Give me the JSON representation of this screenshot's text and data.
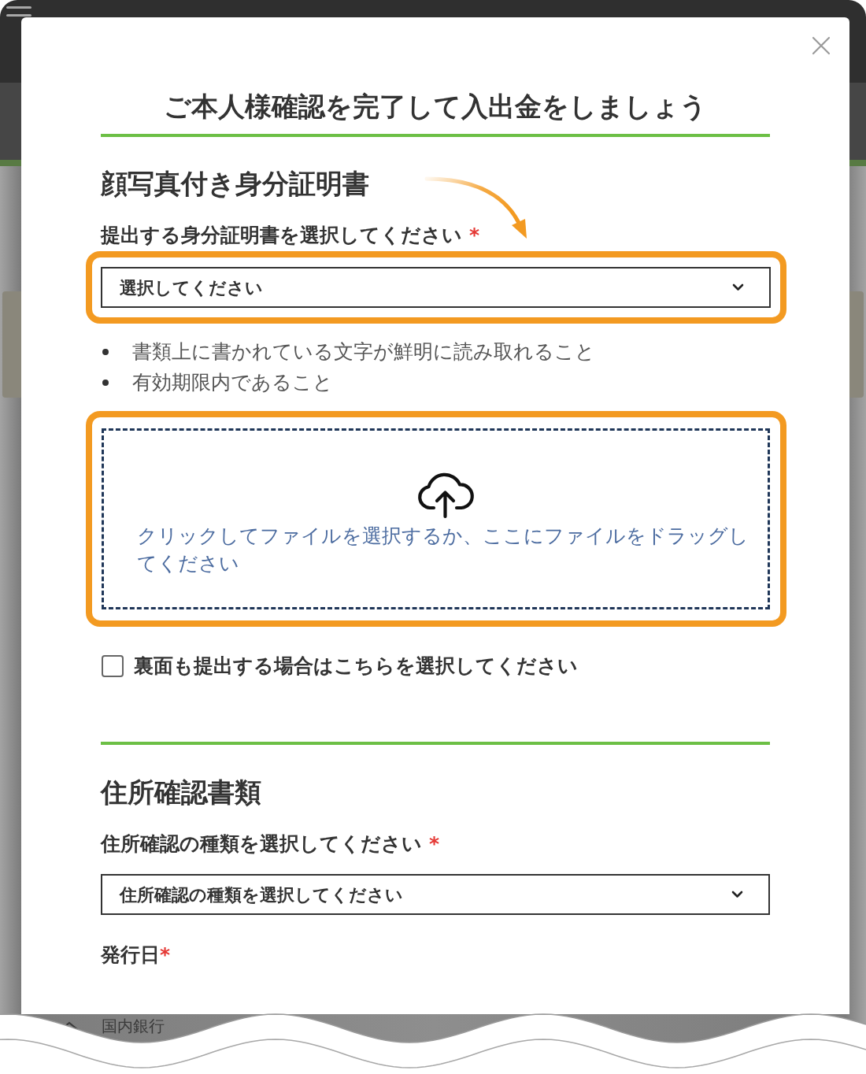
{
  "page": {
    "bottom_item": {
      "label": "国内銀行"
    }
  },
  "modal": {
    "title": "ご本人様確認を完了して入出金をしましょう",
    "sections": [
      {
        "heading": "顔写真付き身分証明書",
        "fields": [
          {
            "kind": "select",
            "label": "提出する身分証明書を選択してください",
            "required_mark": "*",
            "value": "選択してください",
            "highlighted": true,
            "arrow": true
          },
          {
            "kind": "bullets",
            "items": [
              "書類上に書かれている文字が鮮明に読み取れること",
              "有効期限内であること"
            ]
          },
          {
            "kind": "upload",
            "text": "クリックしてファイルを選択するか、ここにファイルをドラッグしてください",
            "highlighted": true
          },
          {
            "kind": "checkbox",
            "label": "裏面も提出する場合はこちらを選択してください",
            "checked": false
          }
        ]
      },
      {
        "heading": "住所確認書類",
        "fields": [
          {
            "kind": "select",
            "label": "住所確認の種類を選択してください",
            "required_mark": "*",
            "value": "住所確認の種類を選択してください",
            "highlighted": false,
            "arrow": false
          },
          {
            "kind": "date",
            "label": "発行日",
            "required_mark": "*"
          }
        ]
      }
    ]
  }
}
